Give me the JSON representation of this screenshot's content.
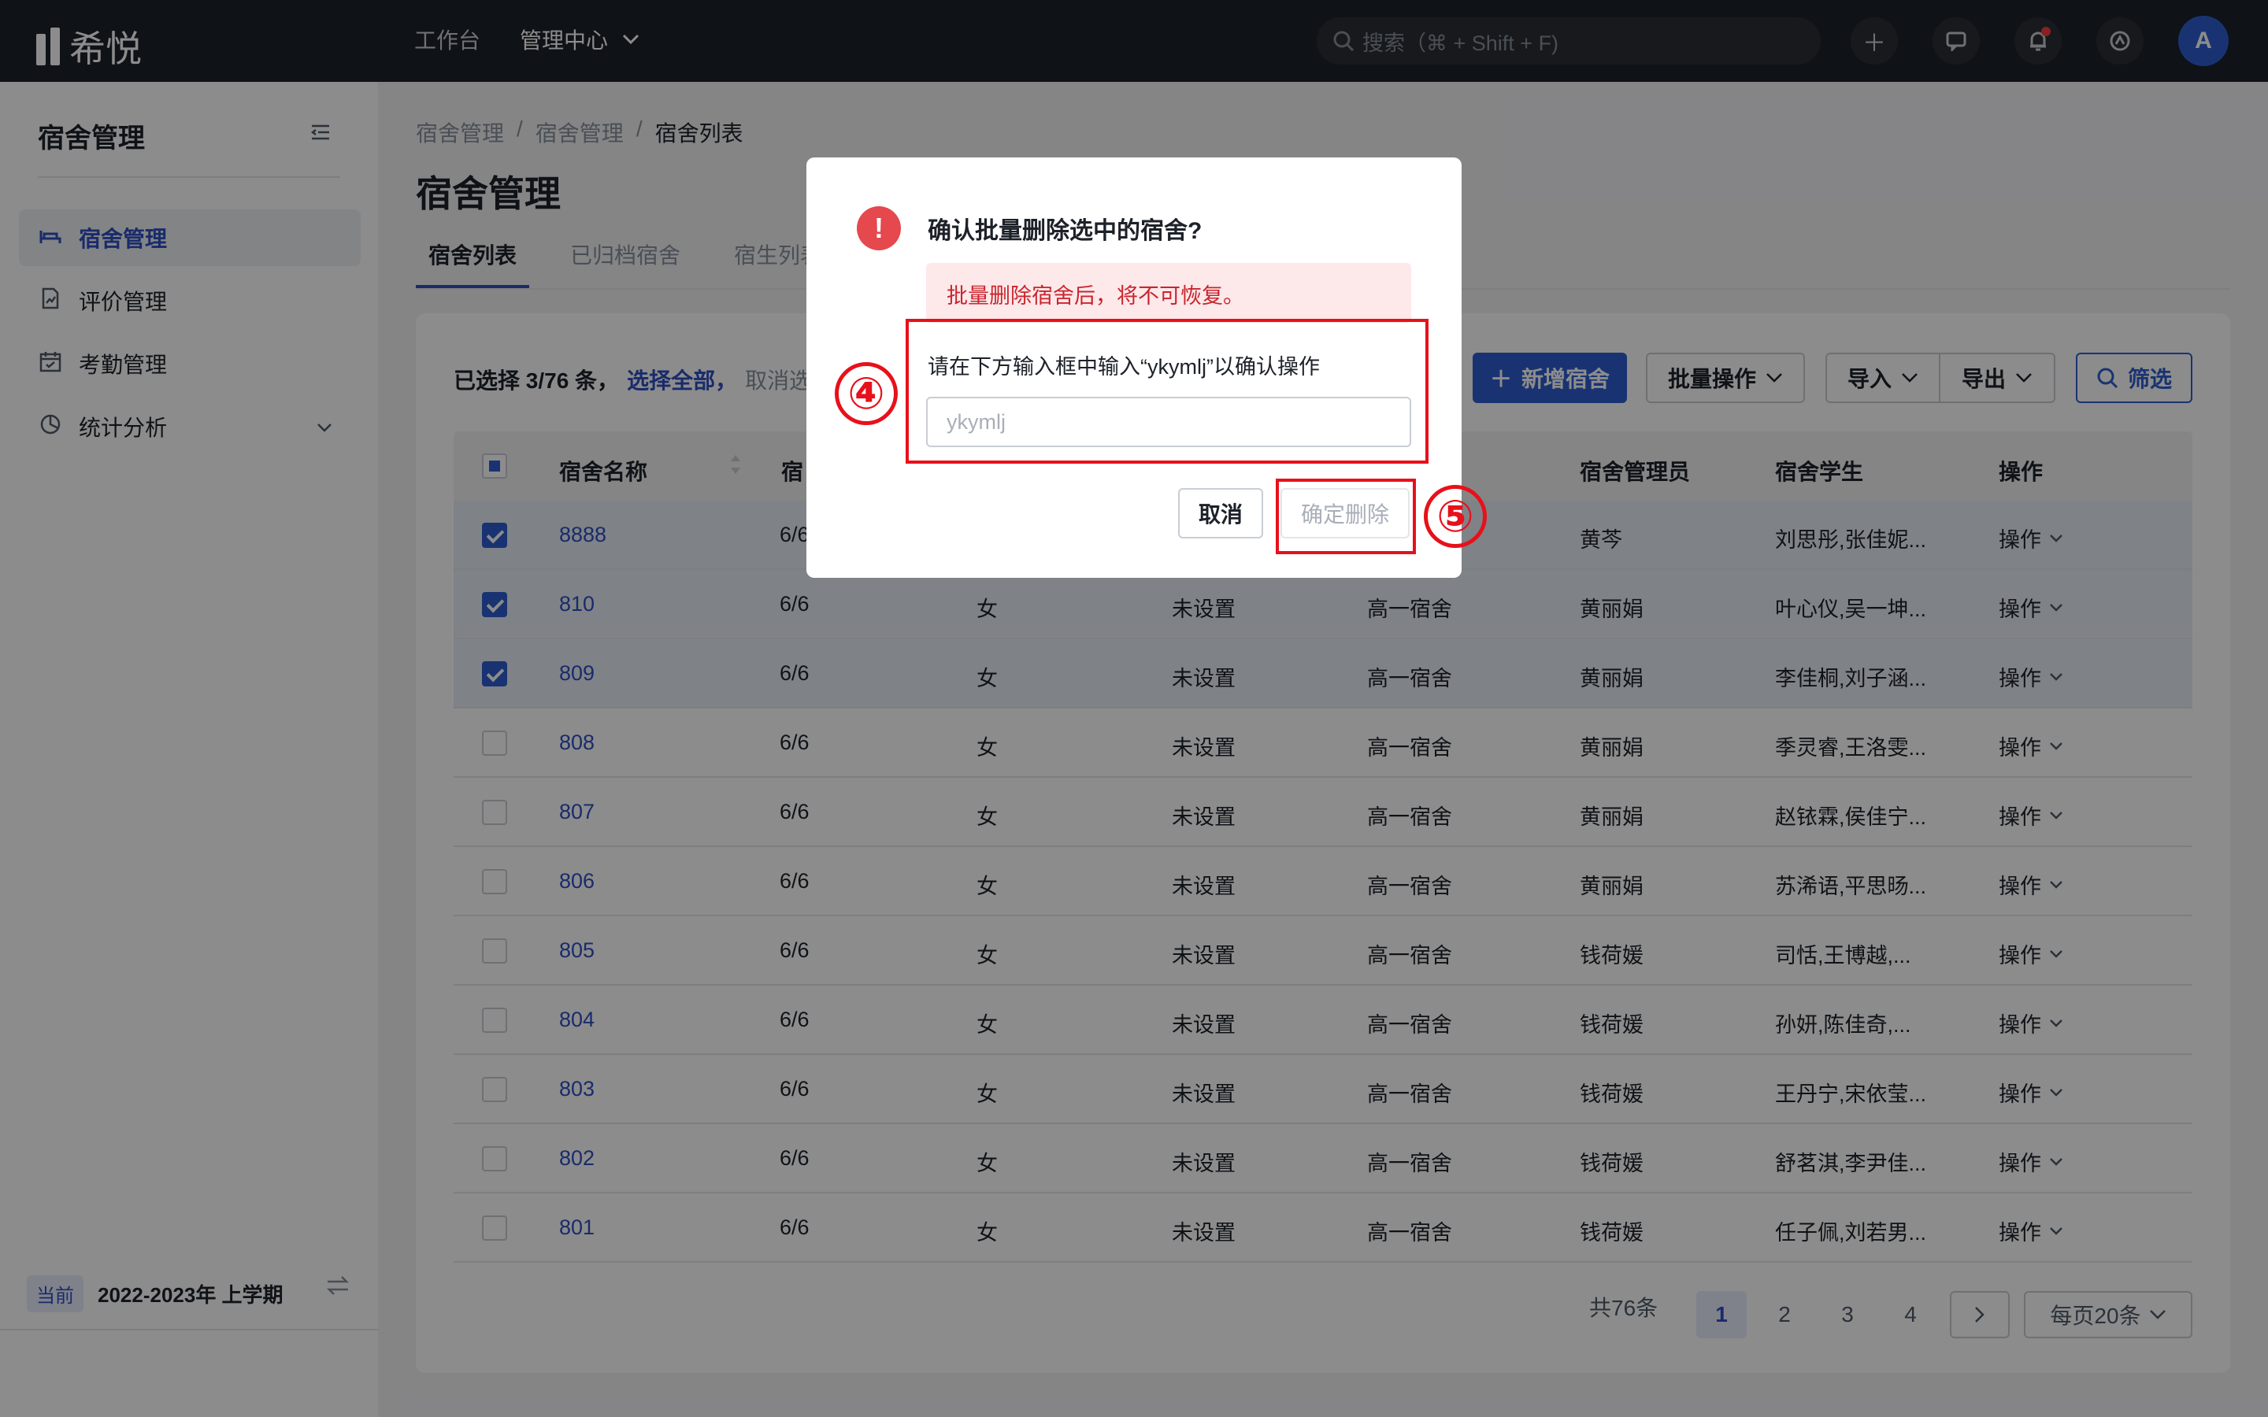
{
  "app": {
    "logo_text": "希悦"
  },
  "topnav": {
    "workbench": "工作台",
    "admin_center": "管理中心"
  },
  "search": {
    "placeholder": "搜索（⌘ + Shift + F)"
  },
  "user": {
    "avatar_letter": "A"
  },
  "sidebar": {
    "title": "宿舍管理",
    "items": [
      {
        "label": "宿舍管理",
        "icon": "bed-icon",
        "active": true
      },
      {
        "label": "评价管理",
        "icon": "evaluation-icon"
      },
      {
        "label": "考勤管理",
        "icon": "calendar-icon"
      },
      {
        "label": "统计分析",
        "icon": "pie-chart-icon",
        "expandable": true
      }
    ],
    "term_badge": "当前",
    "term_text": "2022-2023年 上学期"
  },
  "breadcrumb": [
    "宿舍管理",
    "宿舍管理",
    "宿舍列表"
  ],
  "page_title": "宿舍管理",
  "tabs": [
    "宿舍列表",
    "已归档宿舍",
    "宿生列表"
  ],
  "selection": {
    "info": "已选择 3/76 条，",
    "select_all": "选择全部，",
    "cancel": "取消选择"
  },
  "toolbar": {
    "add": "新增宿舍",
    "batch": "批量操作",
    "import": "导入",
    "export": "导出",
    "filter": "筛选"
  },
  "table": {
    "headers": {
      "name": "宿舍名称",
      "capacity": "宿",
      "manager": "宿舍管理员",
      "students": "宿舍学生",
      "action": "操作"
    },
    "rows": [
      {
        "name": "8888",
        "capacity": "6/6",
        "gender": "",
        "status": "",
        "building": "",
        "manager": "黄芩",
        "students": "刘思彤,张佳妮...",
        "action": "操作",
        "checked": true
      },
      {
        "name": "810",
        "capacity": "6/6",
        "gender": "女",
        "status": "未设置",
        "building": "高一宿舍",
        "manager": "黄丽娟",
        "students": "叶心仪,吴一坤...",
        "action": "操作",
        "checked": true
      },
      {
        "name": "809",
        "capacity": "6/6",
        "gender": "女",
        "status": "未设置",
        "building": "高一宿舍",
        "manager": "黄丽娟",
        "students": "李佳桐,刘子涵...",
        "action": "操作",
        "checked": true
      },
      {
        "name": "808",
        "capacity": "6/6",
        "gender": "女",
        "status": "未设置",
        "building": "高一宿舍",
        "manager": "黄丽娟",
        "students": "季灵睿,王洛雯...",
        "action": "操作",
        "checked": false
      },
      {
        "name": "807",
        "capacity": "6/6",
        "gender": "女",
        "status": "未设置",
        "building": "高一宿舍",
        "manager": "黄丽娟",
        "students": "赵铱霖,侯佳宁...",
        "action": "操作",
        "checked": false
      },
      {
        "name": "806",
        "capacity": "6/6",
        "gender": "女",
        "status": "未设置",
        "building": "高一宿舍",
        "manager": "黄丽娟",
        "students": "苏浠语,平思旸...",
        "action": "操作",
        "checked": false
      },
      {
        "name": "805",
        "capacity": "6/6",
        "gender": "女",
        "status": "未设置",
        "building": "高一宿舍",
        "manager": "钱荷媛",
        "students": "司恬,王博越,...",
        "action": "操作",
        "checked": false
      },
      {
        "name": "804",
        "capacity": "6/6",
        "gender": "女",
        "status": "未设置",
        "building": "高一宿舍",
        "manager": "钱荷媛",
        "students": "孙妍,陈佳奇,...",
        "action": "操作",
        "checked": false
      },
      {
        "name": "803",
        "capacity": "6/6",
        "gender": "女",
        "status": "未设置",
        "building": "高一宿舍",
        "manager": "钱荷媛",
        "students": "王丹宁,宋依莹...",
        "action": "操作",
        "checked": false
      },
      {
        "name": "802",
        "capacity": "6/6",
        "gender": "女",
        "status": "未设置",
        "building": "高一宿舍",
        "manager": "钱荷媛",
        "students": "舒茗淇,李尹佳...",
        "action": "操作",
        "checked": false
      },
      {
        "name": "801",
        "capacity": "6/6",
        "gender": "女",
        "status": "未设置",
        "building": "高一宿舍",
        "manager": "钱荷媛",
        "students": "任子佩,刘若男...",
        "action": "操作",
        "checked": false
      }
    ]
  },
  "pagination": {
    "total": "共76条",
    "pages": [
      "1",
      "2",
      "3",
      "4"
    ],
    "current": "1",
    "page_size": "每页20条"
  },
  "dialog": {
    "title": "确认批量删除选中的宿舍?",
    "warning": "批量删除宿舍后，将不可恢复。",
    "prompt": "请在下方输入框中输入“ykymlj”以确认操作",
    "input_value": "",
    "input_placeholder": "ykymlj",
    "cancel": "取消",
    "confirm": "确定删除"
  },
  "annotations": {
    "step4": "④",
    "step5": "⑤",
    "color": "#e8101a"
  }
}
